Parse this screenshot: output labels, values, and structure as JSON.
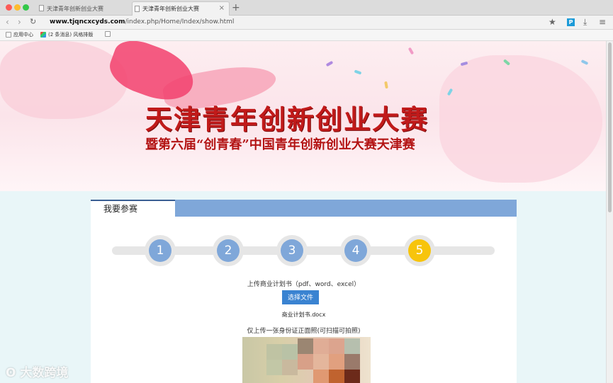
{
  "browser": {
    "tabs": [
      {
        "title": "天津青年创新创业大赛"
      },
      {
        "title": "天津青年创新创业大赛"
      }
    ],
    "new_tab": "+",
    "close": "×",
    "url_host": "www.tjqncxcyds.com",
    "url_path": "/index.php/Home/Index/show.html",
    "bookmarks": [
      {
        "label": "应用中心"
      },
      {
        "label": "(2 条消息) 风格排版"
      }
    ],
    "toolbar_icons": [
      "back-icon",
      "forward-icon",
      "reload-icon",
      "star-icon",
      "parking-icon",
      "download-icon",
      "menu-icon"
    ]
  },
  "banner": {
    "title": "天津青年创新创业大赛",
    "subtitle": "暨第六届“创青春”中国青年创新创业大赛天津赛"
  },
  "card": {
    "tab_label": "我要参赛",
    "steps": [
      "1",
      "2",
      "3",
      "4",
      "5"
    ],
    "active_step": 5,
    "upload_label": "上传商业计划书（pdf、word、excel）",
    "choose_button": "选择文件",
    "filename": "商业计划书.docx",
    "id_label": "仅上传一张身份证正面照(可扫描可拍照)"
  },
  "watermark": "大数跨境",
  "colors": {
    "step": "#7fa7d9",
    "active_step": "#f7c40c",
    "button": "#3a83d1",
    "header_bar": "#7fa7d9"
  }
}
